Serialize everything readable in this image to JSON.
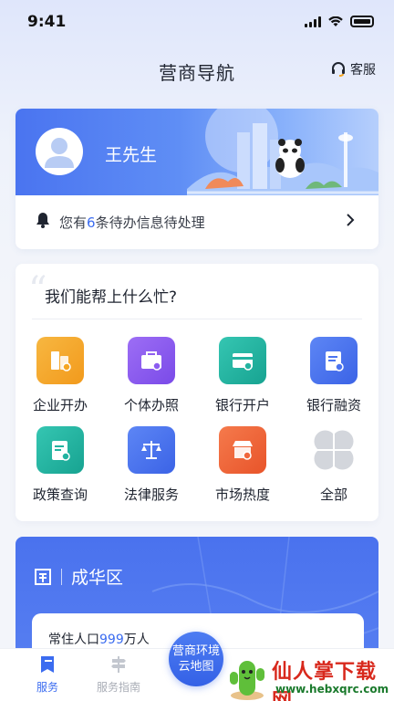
{
  "status_bar": {
    "time": "9:41"
  },
  "header": {
    "title": "营商导航",
    "service_label": "客服"
  },
  "user": {
    "name": "王先生"
  },
  "notice": {
    "prefix": "您有",
    "count": "6",
    "suffix": "条待办信息待处理"
  },
  "help": {
    "title": "我们能帮上什么忙?",
    "items": [
      {
        "label": "企业开办",
        "icon": "building-icon",
        "color": "#f5a623"
      },
      {
        "label": "个体办照",
        "icon": "shop-bag-icon",
        "color": "#8b5cf0"
      },
      {
        "label": "银行开户",
        "icon": "bank-card-icon",
        "color": "#22b3a0"
      },
      {
        "label": "银行融资",
        "icon": "finance-doc-icon",
        "color": "#4b74f0"
      },
      {
        "label": "政策查询",
        "icon": "policy-doc-icon",
        "color": "#22b3a0"
      },
      {
        "label": "法律服务",
        "icon": "scale-icon",
        "color": "#4b74f0"
      },
      {
        "label": "市场热度",
        "icon": "market-icon",
        "color": "#f0663c"
      },
      {
        "label": "全部",
        "icon": "four-petal-icon",
        "color": "#c9ccd3"
      }
    ]
  },
  "district": {
    "name": "成华区",
    "pop_prefix": "常住人口",
    "pop_value": "999",
    "pop_unit": "万人"
  },
  "bottom_nav": {
    "services": "服务",
    "guide": "服务指南",
    "map_line1": "营商环境",
    "map_line2": "云地图"
  },
  "watermark": {
    "title": "仙人掌下载网",
    "url": "www.hebxqrc.com"
  },
  "colors": {
    "accent": "#3b6cf0",
    "banner": "#4a74f0"
  }
}
